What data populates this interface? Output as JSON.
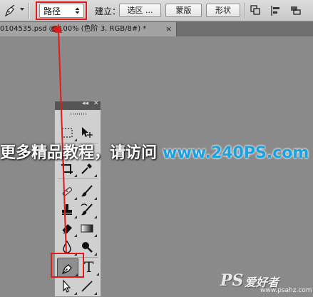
{
  "options_bar": {
    "tool_icon": "pen-tool-icon",
    "mode_value": "路径",
    "make_label": "建立：",
    "selection_button": "选区 ...",
    "mask_button": "蒙版",
    "shape_button": "形状",
    "path_ops_icon": "path-operations-icon",
    "path_align_icon": "path-alignment-icon",
    "path_arrange_icon": "path-arrangement-icon"
  },
  "document_tab": {
    "title": "0104535.psd @ 100% (色阶 3, RGB/8#) *",
    "close": "×"
  },
  "tools_panel": {
    "collapse": "◂◂",
    "close": "✕",
    "tools": [
      "marquee-tool-icon",
      "move-tool-icon",
      "crop-tool-icon",
      "eyedropper-tool-icon",
      "healing-brush-icon",
      "brush-tool-icon",
      "clone-stamp-icon",
      "history-brush-icon",
      "eraser-tool-icon",
      "gradient-tool-icon",
      "blur-tool-icon",
      "dodge-tool-icon",
      "pen-tool-icon",
      "type-tool-icon",
      "path-selection-icon",
      "line-tool-icon"
    ],
    "type_glyph": "T"
  },
  "banner": {
    "text": "更多精品教程，请访问",
    "site": "www.240PS.com"
  },
  "watermark": {
    "ps": "PS",
    "cn": "爱好者",
    "url": "www.psahz.com"
  },
  "colors": {
    "highlight": "#e21a1a",
    "site_blue": "#1aa1e0",
    "canvas": "#8a8a8a"
  }
}
